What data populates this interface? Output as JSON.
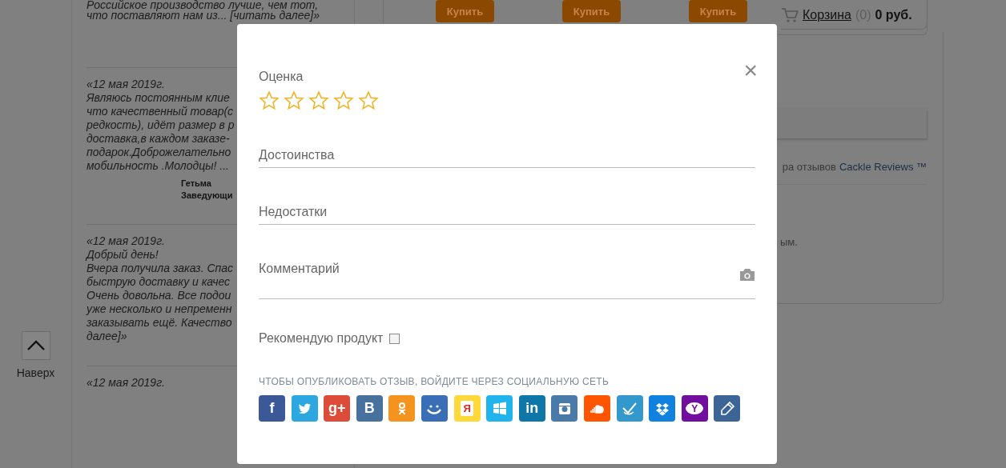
{
  "page": {
    "back_to_top": "Наверх",
    "reviews": [
      {
        "lines": [
          "Российское производство лучше, чем тот,",
          "что поставляют нам из... [читать далее]»"
        ]
      },
      {
        "lines": [
          "«12 мая 2019г.",
          "Являюсь постоянным клие",
          "что качественный товар(с",
          "редкость), идёт размер в р",
          "доставка,в каждом заказе-",
          "подарок.Доброжелательно",
          "мобильность .Молодцы! ..."
        ],
        "author": [
          "Гетьма",
          "Заведующи"
        ]
      },
      {
        "lines": [
          "«12 мая 2019г.",
          "Добрый день!",
          "Вчера получила заказ. Спас",
          "быструю доставку и качес",
          "Очень довольна. Все подои",
          "уже несколько и непременн",
          "заказывать ещё. Качество",
          "далее]»"
        ]
      },
      {
        "lines": [
          "«12 мая 2019г."
        ]
      }
    ],
    "buy_buttons": [
      "Купить",
      "Купить",
      "Купить"
    ],
    "cart": {
      "label": "Корзина",
      "count": "(0)",
      "total": "0 руб."
    },
    "powered": {
      "text": "ра отзывов",
      "link": "Cackle Reviews ™"
    },
    "note": "ым."
  },
  "modal": {
    "close": "×",
    "rating": {
      "label": "Оценка",
      "stars": 0
    },
    "fields": [
      {
        "kind": "text",
        "placeholder": "Достоинства"
      },
      {
        "kind": "text",
        "placeholder": "Недостатки"
      },
      {
        "kind": "comment",
        "placeholder": "Комментарий"
      }
    ],
    "recommend": {
      "label": "Рекомендую продукт",
      "checked": false
    },
    "social_prompt": "ЧТОБЫ ОПУБЛИКОВАТЬ ОТЗЫВ, ВОЙДИТЕ ЧЕРЕЗ СОЦИАЛЬНУЮ СЕТЬ",
    "social": [
      {
        "kind": "glyph",
        "glyph": "f",
        "color": "#3b5998"
      },
      {
        "kind": "bird",
        "color": "#2ca7e0"
      },
      {
        "kind": "glyph",
        "glyph": "g+",
        "color": "#dd4b39"
      },
      {
        "kind": "glyph",
        "glyph": "B",
        "color": "#48729e"
      },
      {
        "kind": "person",
        "color": "#f4931e"
      },
      {
        "kind": "smile",
        "color": "#3a6fb8"
      },
      {
        "kind": "yandex",
        "glyph": "Я",
        "color": "#ffd83a"
      },
      {
        "kind": "windows",
        "color": "#21b4ec"
      },
      {
        "kind": "glyph",
        "glyph": "in",
        "color": "#0e76a8"
      },
      {
        "kind": "camera",
        "color": "#4a7aa7"
      },
      {
        "kind": "cloud",
        "color": "#ff5500"
      },
      {
        "kind": "check",
        "color": "#3399cc"
      },
      {
        "kind": "box",
        "color": "#1081de"
      },
      {
        "kind": "yahoo",
        "glyph": "Y",
        "color": "#720e9e"
      },
      {
        "kind": "pencil",
        "color": "#3c6496"
      }
    ]
  }
}
